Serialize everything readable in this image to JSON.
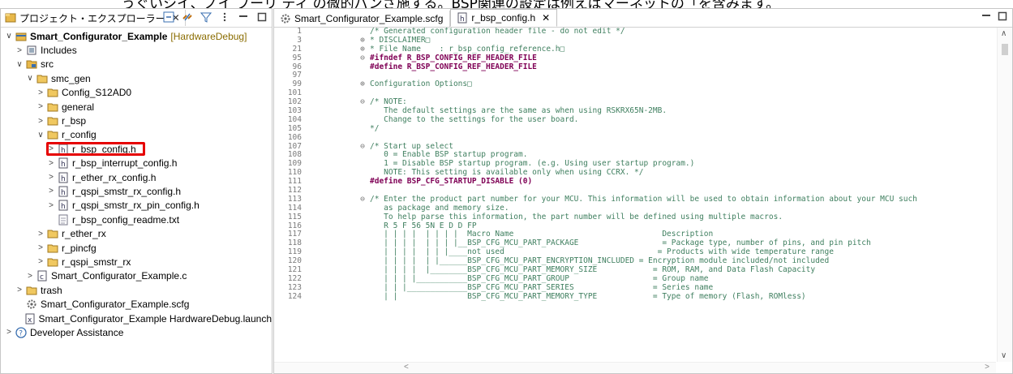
{
  "top_strip_text": "うぐいシイ、ノイ ブーリ ディ の微的パンさ施する。BSP関連の設定は例えばマーネットの「を含みます。",
  "explorer": {
    "tab_title": "プロジェクト・エクスプローラー",
    "tree": [
      {
        "depth": 0,
        "twisty": "open",
        "icon": "project-icon",
        "label": "Smart_Configurator_Example",
        "deco": "[HardwareDebug]",
        "bold": true
      },
      {
        "depth": 1,
        "twisty": "closed",
        "icon": "includes-icon",
        "label": "Includes"
      },
      {
        "depth": 1,
        "twisty": "open",
        "icon": "source-folder-icon",
        "label": "src"
      },
      {
        "depth": 2,
        "twisty": "open",
        "icon": "folder-icon",
        "label": "smc_gen"
      },
      {
        "depth": 3,
        "twisty": "closed",
        "icon": "folder-icon",
        "label": "Config_S12AD0"
      },
      {
        "depth": 3,
        "twisty": "closed",
        "icon": "folder-icon",
        "label": "general"
      },
      {
        "depth": 3,
        "twisty": "closed",
        "icon": "folder-icon",
        "label": "r_bsp"
      },
      {
        "depth": 3,
        "twisty": "open",
        "icon": "folder-icon",
        "label": "r_config"
      },
      {
        "depth": 4,
        "twisty": "closed",
        "icon": "header-file-icon",
        "label": "r_bsp_config.h",
        "selected": true
      },
      {
        "depth": 4,
        "twisty": "closed",
        "icon": "header-file-icon",
        "label": "r_bsp_interrupt_config.h"
      },
      {
        "depth": 4,
        "twisty": "closed",
        "icon": "header-file-icon",
        "label": "r_ether_rx_config.h"
      },
      {
        "depth": 4,
        "twisty": "closed",
        "icon": "header-file-icon",
        "label": "r_qspi_smstr_rx_config.h"
      },
      {
        "depth": 4,
        "twisty": "closed",
        "icon": "header-file-icon",
        "label": "r_qspi_smstr_rx_pin_config.h"
      },
      {
        "depth": 4,
        "twisty": "none",
        "icon": "text-file-icon",
        "label": "r_bsp_config_readme.txt"
      },
      {
        "depth": 3,
        "twisty": "closed",
        "icon": "folder-icon",
        "label": "r_ether_rx"
      },
      {
        "depth": 3,
        "twisty": "closed",
        "icon": "folder-icon",
        "label": "r_pincfg"
      },
      {
        "depth": 3,
        "twisty": "closed",
        "icon": "folder-icon",
        "label": "r_qspi_smstr_rx"
      },
      {
        "depth": 2,
        "twisty": "closed",
        "icon": "c-file-icon",
        "label": "Smart_Configurator_Example.c"
      },
      {
        "depth": 1,
        "twisty": "closed",
        "icon": "folder-icon",
        "label": "trash"
      },
      {
        "depth": 1,
        "twisty": "none",
        "icon": "gear-icon",
        "label": "Smart_Configurator_Example.scfg"
      },
      {
        "depth": 1,
        "twisty": "none",
        "icon": "launch-icon",
        "label": "Smart_Configurator_Example HardwareDebug.launch"
      },
      {
        "depth": 0,
        "twisty": "closed",
        "icon": "help-icon",
        "label": "Developer Assistance"
      }
    ]
  },
  "editor": {
    "tabs": [
      {
        "label": "Smart_Configurator_Example.scfg",
        "icon": "gear-icon",
        "active": false
      },
      {
        "label": "r_bsp_config.h",
        "icon": "header-file-icon",
        "active": true
      }
    ],
    "lines": [
      {
        "n": "1",
        "fold": "",
        "cls": "c-comment",
        "t": "/* Generated configuration header file - do not edit */"
      },
      {
        "n": "3",
        "fold": "⊕",
        "cls": "c-comment",
        "t": "* DISCLAIMER□"
      },
      {
        "n": "21",
        "fold": "⊕",
        "cls": "c-comment",
        "t": "* File Name    : r_bsp_config_reference.h□"
      },
      {
        "n": "95",
        "fold": "⊖",
        "cls": "c-pre",
        "t": "#ifndef R_BSP_CONFIG_REF_HEADER_FILE"
      },
      {
        "n": "96",
        "fold": "",
        "cls": "c-pre",
        "t": "#define R_BSP_CONFIG_REF_HEADER_FILE"
      },
      {
        "n": "97",
        "fold": "",
        "cls": "c-norm",
        "t": ""
      },
      {
        "n": "99",
        "fold": "⊕",
        "cls": "c-comment",
        "t": "Configuration Options□"
      },
      {
        "n": "101",
        "fold": "",
        "cls": "c-norm",
        "t": ""
      },
      {
        "n": "102",
        "fold": "⊖",
        "cls": "c-comment",
        "t": "/* NOTE:"
      },
      {
        "n": "103",
        "fold": "",
        "cls": "c-comment",
        "t": "   The default settings are the same as when using RSKRX65N-2MB."
      },
      {
        "n": "104",
        "fold": "",
        "cls": "c-comment",
        "t": "   Change to the settings for the user board."
      },
      {
        "n": "105",
        "fold": "",
        "cls": "c-comment",
        "t": "*/"
      },
      {
        "n": "106",
        "fold": "",
        "cls": "c-norm",
        "t": ""
      },
      {
        "n": "107",
        "fold": "⊖",
        "cls": "c-comment",
        "t": "/* Start up select"
      },
      {
        "n": "108",
        "fold": "",
        "cls": "c-comment",
        "t": "   0 = Enable BSP startup program."
      },
      {
        "n": "109",
        "fold": "",
        "cls": "c-comment",
        "t": "   1 = Disable BSP startup program. (e.g. Using user startup program.)"
      },
      {
        "n": "110",
        "fold": "",
        "cls": "c-comment",
        "t": "   NOTE: This setting is available only when using CCRX. */"
      },
      {
        "n": "111",
        "fold": "",
        "cls": "c-pre",
        "t": "#define BSP_CFG_STARTUP_DISABLE (0)"
      },
      {
        "n": "112",
        "fold": "",
        "cls": "c-norm",
        "t": ""
      },
      {
        "n": "113",
        "fold": "⊖",
        "cls": "c-comment",
        "t": "/* Enter the product part number for your MCU. This information will be used to obtain information about your MCU such"
      },
      {
        "n": "114",
        "fold": "",
        "cls": "c-comment",
        "t": "   as package and memory size."
      },
      {
        "n": "115",
        "fold": "",
        "cls": "c-comment",
        "t": "   To help parse this information, the part number will be defined using multiple macros."
      },
      {
        "n": "116",
        "fold": "",
        "cls": "c-comment",
        "t": "   R 5 F 56 5N E D D FP"
      },
      {
        "n": "117",
        "fold": "",
        "cls": "c-comment",
        "t": "   | | | |  | | | |  Macro Name                                Description"
      },
      {
        "n": "118",
        "fold": "",
        "cls": "c-comment",
        "t": "   | | | |  | | | |__BSP_CFG_MCU_PART_PACKAGE                  = Package type, number of pins, and pin pitch"
      },
      {
        "n": "119",
        "fold": "",
        "cls": "c-comment",
        "t": "   | | | |  | | |____not used                                 = Products with wide temperature range"
      },
      {
        "n": "120",
        "fold": "",
        "cls": "c-comment",
        "t": "   | | | |  | |______BSP_CFG_MCU_PART_ENCRYPTION_INCLUDED = Encryption module included/not included"
      },
      {
        "n": "121",
        "fold": "",
        "cls": "c-comment",
        "t": "   | | | |  |________BSP_CFG_MCU_PART_MEMORY_SIZE            = ROM, RAM, and Data Flash Capacity"
      },
      {
        "n": "122",
        "fold": "",
        "cls": "c-comment",
        "t": "   | | | |___________BSP_CFG_MCU_PART_GROUP                  = Group name"
      },
      {
        "n": "123",
        "fold": "",
        "cls": "c-comment",
        "t": "   | | |_____________BSP_CFG_MCU_PART_SERIES                 = Series name"
      },
      {
        "n": "124",
        "fold": "",
        "cls": "c-comment",
        "t": "   | |               BSP_CFG_MCU_PART_MEMORY_TYPE            = Type of memory (Flash, ROMless)"
      }
    ]
  },
  "colors": {
    "highlight": "#e60000",
    "comment": "#3f7f5f",
    "preprocessor": "#7f0055",
    "folder": "#e8b84a"
  }
}
